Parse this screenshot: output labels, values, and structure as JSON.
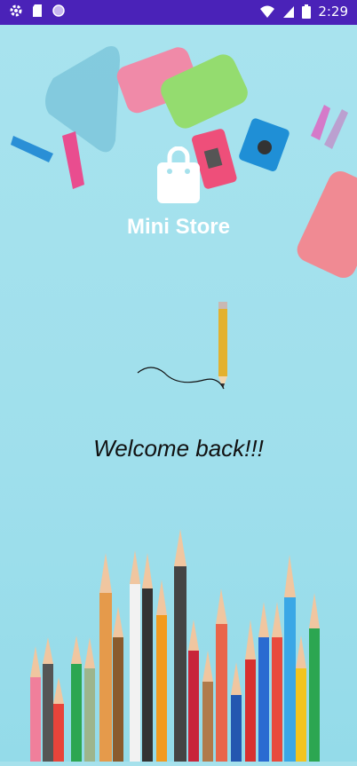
{
  "status_bar": {
    "time": "2:29",
    "left_icons": [
      "gear-icon",
      "sd-card-icon",
      "circle-icon"
    ],
    "right_icons": [
      "wifi-icon",
      "cell-signal-icon",
      "battery-icon"
    ]
  },
  "brand": {
    "icon": "shopping-bag-icon",
    "title": "Mini Store"
  },
  "welcome": {
    "message": "Welcome back!!!"
  },
  "colors": {
    "status_bar": "#4a22b8",
    "background": "#a6e1ec",
    "brand_text": "#ffffff",
    "welcome_text": "#111111"
  }
}
